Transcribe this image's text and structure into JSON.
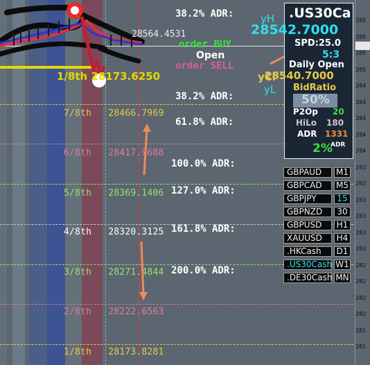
{
  "murray_levels": [
    {
      "label": "7/8th",
      "price": "28466.7969",
      "color": "#e8c94a"
    },
    {
      "label": "6/8th",
      "price": "28417.9688",
      "color": "#e07aa0"
    },
    {
      "label": "5/8th",
      "price": "28369.1406",
      "color": "#9be06a"
    },
    {
      "label": "4/8th",
      "price": "28320.3125",
      "color": "#ffffff"
    },
    {
      "label": "3/8th",
      "price": "28271.4844",
      "color": "#9be06a"
    },
    {
      "label": "2/8th",
      "price": "28222.6563",
      "color": "#e07aa0"
    },
    {
      "label": "1/8th",
      "price": "28173.8281",
      "color": "#e8c94a"
    },
    {
      "label": "1/8th",
      "price": "28173.8281",
      "color": "#e8c94a"
    }
  ],
  "top_level": {
    "label": "1/8th",
    "price": "28173.6250"
  },
  "partial_price": "28564.4531",
  "adr_labels": [
    "38.2% ADR:",
    "38.2% ADR:",
    "61.8% ADR:",
    "100.0% ADR:",
    "127.0% ADR:",
    "161.8% ADR:",
    "200.0% ADR:"
  ],
  "order_buy": "order BUY",
  "open_label": "Open",
  "order_sell": "order SELL",
  "yh": "yH",
  "yl": "yL",
  "ycl": "yCl",
  "panel": {
    "symbol": ".US30Ca",
    "price": "28542.7000",
    "spread": "SPD:25.0",
    "ratio": "5:3",
    "daily_open_label": "Daily Open",
    "daily_open_value": "28540.7000",
    "bidratio_label": "BidRatio",
    "bidratio_value": "50%",
    "p2op_label": "P2Op",
    "p2op_value": "20",
    "hilo_label": "HiLo",
    "hilo_value": "180",
    "adr_label": "ADR",
    "adr_value": "1331",
    "adr_pct": "2%",
    "adr_pct_suffix": "ADR"
  },
  "symbols": [
    {
      "name": "GBPAUD",
      "tf": "M1"
    },
    {
      "name": "GBPCAD",
      "tf": "M5"
    },
    {
      "name": "GBPJPY",
      "tf": "15"
    },
    {
      "name": "GBPNZD",
      "tf": "30"
    },
    {
      "name": "GBPUSD",
      "tf": "H1"
    },
    {
      "name": "XAUUSD",
      "tf": "H4"
    },
    {
      "name": ".HKCash",
      "tf": "D1"
    },
    {
      "name": ".US30Cash",
      "tf": "W1"
    },
    {
      "name": ".DE30Cash",
      "tf": "MN"
    }
  ],
  "axis_ticks": [
    "285",
    "285",
    "285",
    "285",
    "284",
    "284",
    "284",
    "284",
    "284",
    "283",
    "283",
    "283",
    "283",
    "283",
    "282",
    "282",
    "282",
    "282",
    "282",
    "281",
    "281"
  ],
  "colors": {
    "background": "#5b6670",
    "cyan": "#2de0f0",
    "buy": "#3fe03f",
    "sell": "#e05aa0",
    "gold": "#e8c94a",
    "arrow": "#f08a5a"
  }
}
